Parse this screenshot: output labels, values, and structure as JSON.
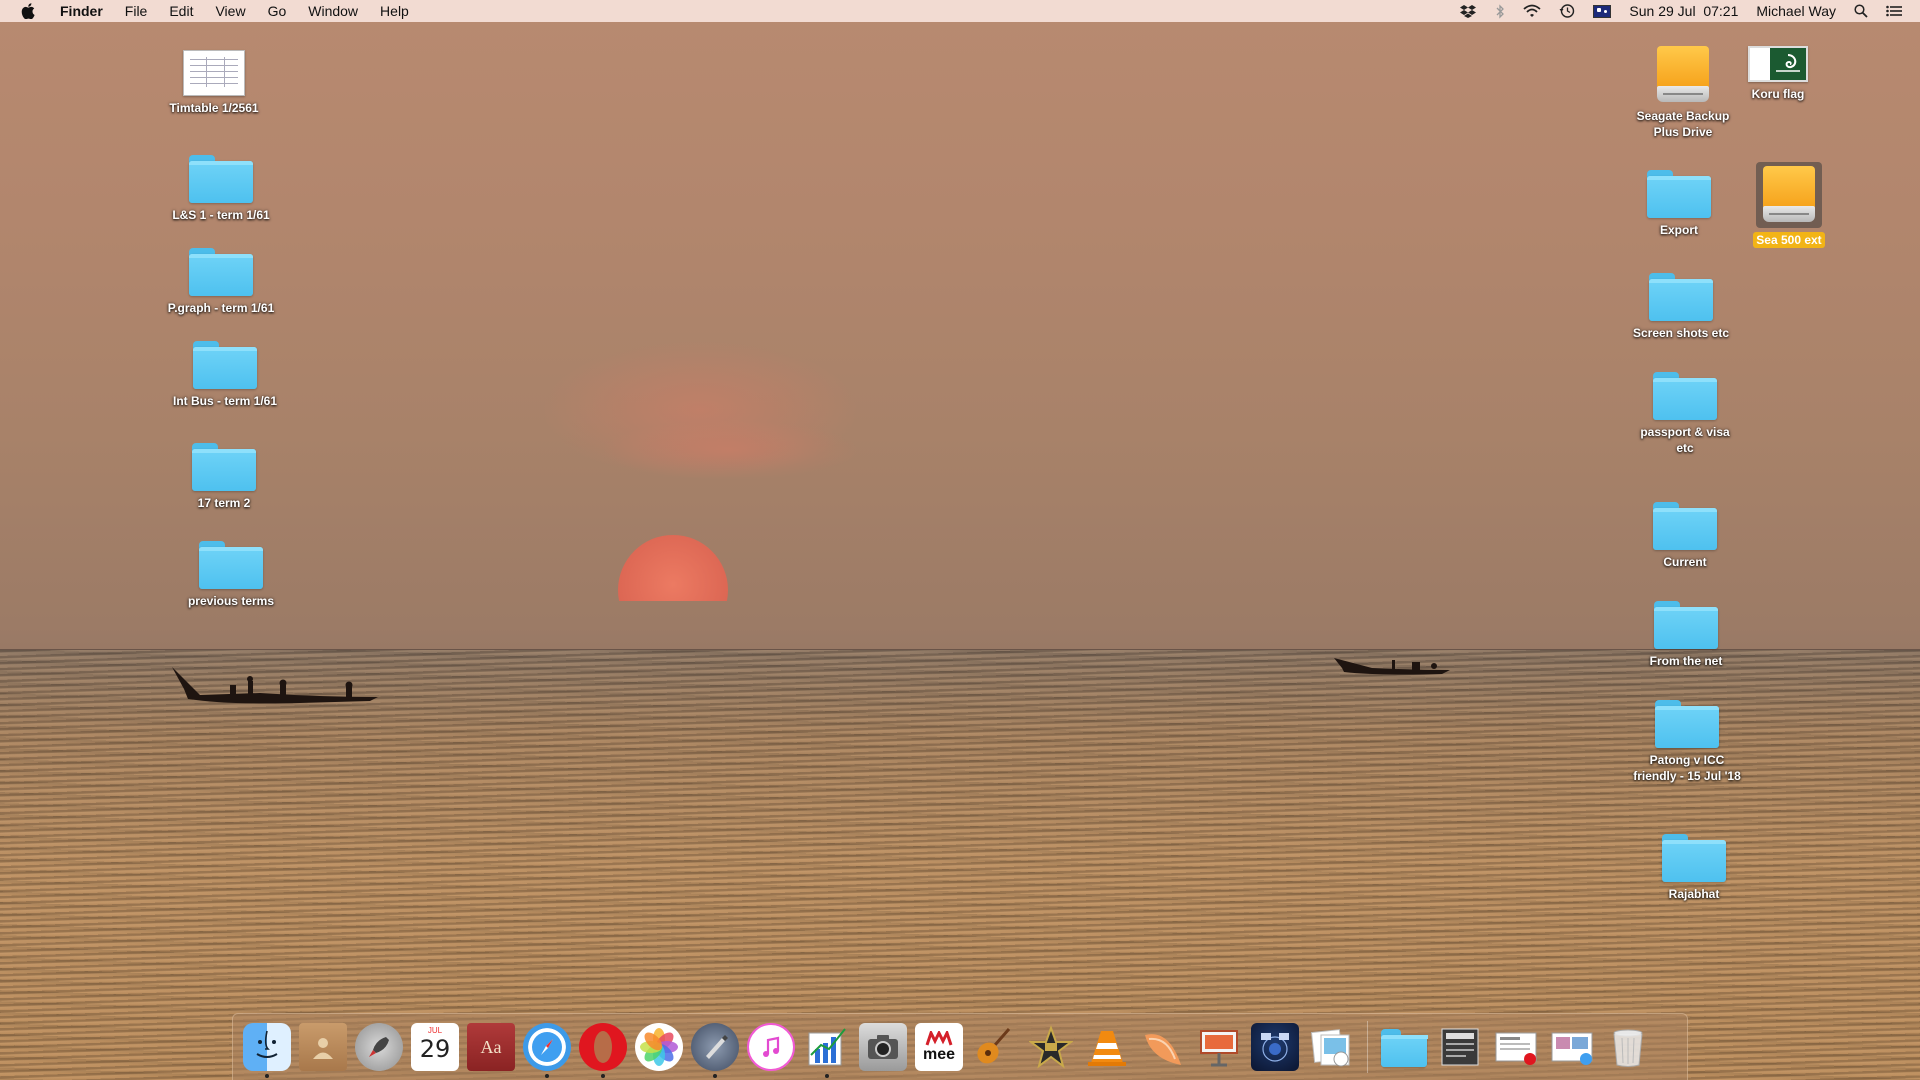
{
  "menubar": {
    "app_name": "Finder",
    "menus": [
      "File",
      "Edit",
      "View",
      "Go",
      "Window",
      "Help"
    ],
    "datetime": "Sun 29 Jul  07:21",
    "user": "Michael Way",
    "status_icons": [
      "dropbox-icon",
      "bluetooth-icon",
      "wifi-icon",
      "time-machine-icon",
      "input-flag-icon",
      "spotlight-icon",
      "notification-center-icon"
    ]
  },
  "desktop_left": [
    {
      "label": "Timtable 1/2561",
      "type": "document"
    },
    {
      "label": "L&S 1 - term 1/61",
      "type": "folder"
    },
    {
      "label": "P.graph - term 1/61",
      "type": "folder"
    },
    {
      "label": "Int Bus - term 1/61",
      "type": "folder"
    },
    {
      "label": "17 term 2",
      "type": "folder"
    },
    {
      "label": "previous terms",
      "type": "folder"
    }
  ],
  "desktop_right": [
    {
      "label": "Seagate Backup Plus Drive",
      "type": "drive"
    },
    {
      "label": "Koru flag",
      "type": "image"
    },
    {
      "label": "Export",
      "type": "folder"
    },
    {
      "label": "Sea 500 ext",
      "type": "drive",
      "selected": true
    },
    {
      "label": "Screen shots etc",
      "type": "folder"
    },
    {
      "label": "passport & visa etc",
      "type": "folder"
    },
    {
      "label": "Current",
      "type": "folder"
    },
    {
      "label": "From the net",
      "type": "folder"
    },
    {
      "label": "Patong v ICC friendly - 15 Jul '18",
      "type": "folder"
    },
    {
      "label": "Rajabhat",
      "type": "folder"
    }
  ],
  "dock": {
    "calendar_day": "29",
    "calendar_month": "JUL",
    "dictionary_glyph": "Aa",
    "mee_label": "mee",
    "items": [
      "Finder",
      "Contacts",
      "Launchpad",
      "Calendar",
      "Dictionary",
      "Safari",
      "Opera",
      "Photos",
      "Script Editor",
      "iTunes",
      "Grapher",
      "Screenshot",
      "Macmillan mee",
      "GarageBand",
      "iMovie",
      "VLC",
      "Squash",
      "Keynote",
      "Mission Control",
      "Preview",
      "Downloads",
      "Stack 1",
      "Stack 2",
      "Stack 3",
      "Trash"
    ],
    "running": [
      "Finder",
      "Safari",
      "Opera",
      "Script Editor",
      "Grapher"
    ]
  },
  "colors": {
    "folder": "#5cc8f2",
    "selected_label": "#f2b416",
    "menubar": "#f6e2da"
  }
}
